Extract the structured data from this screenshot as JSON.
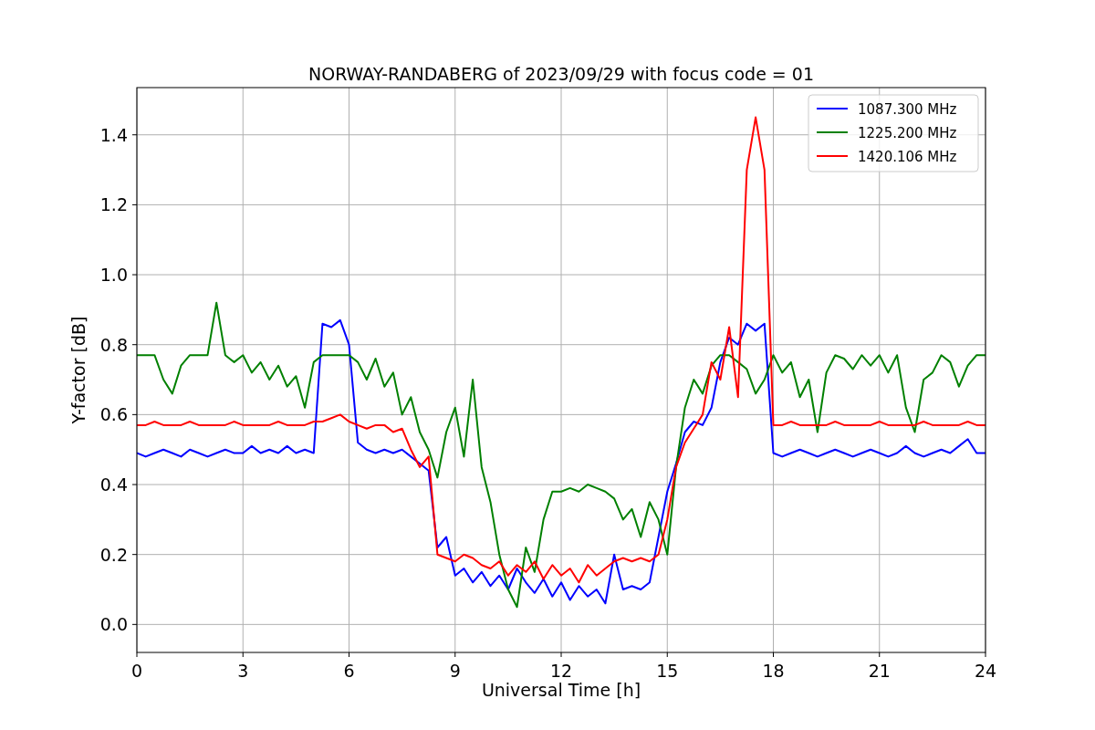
{
  "chart_data": {
    "type": "line",
    "title": "NORWAY-RANDABERG of 2023/09/29 with focus code = 01",
    "xlabel": "Universal Time [h]",
    "ylabel": "Y-factor [dB]",
    "x": [
      0,
      0.25,
      0.5,
      0.75,
      1,
      1.25,
      1.5,
      1.75,
      2,
      2.25,
      2.5,
      2.75,
      3,
      3.25,
      3.5,
      3.75,
      4,
      4.25,
      4.5,
      4.75,
      5,
      5.25,
      5.5,
      5.75,
      6,
      6.25,
      6.5,
      6.75,
      7,
      7.25,
      7.5,
      7.75,
      8,
      8.25,
      8.5,
      8.75,
      9,
      9.25,
      9.5,
      9.75,
      10,
      10.25,
      10.5,
      10.75,
      11,
      11.25,
      11.5,
      11.75,
      12,
      12.25,
      12.5,
      12.75,
      13,
      13.25,
      13.5,
      13.75,
      14,
      14.25,
      14.5,
      14.75,
      15,
      15.25,
      15.5,
      15.75,
      16,
      16.25,
      16.5,
      16.75,
      17,
      17.25,
      17.5,
      17.75,
      18,
      18.25,
      18.5,
      18.75,
      19,
      19.25,
      19.5,
      19.75,
      20,
      20.25,
      20.5,
      20.75,
      21,
      21.25,
      21.5,
      21.75,
      22,
      22.25,
      22.5,
      22.75,
      23,
      23.25,
      23.5,
      23.75,
      24
    ],
    "series": [
      {
        "name": "1087.300 MHz",
        "color": "#0000ff",
        "values": [
          0.49,
          0.48,
          0.49,
          0.5,
          0.49,
          0.48,
          0.5,
          0.49,
          0.48,
          0.49,
          0.5,
          0.49,
          0.49,
          0.51,
          0.49,
          0.5,
          0.49,
          0.51,
          0.49,
          0.5,
          0.49,
          0.86,
          0.85,
          0.87,
          0.8,
          0.52,
          0.5,
          0.49,
          0.5,
          0.49,
          0.5,
          0.48,
          0.46,
          0.44,
          0.22,
          0.25,
          0.14,
          0.16,
          0.12,
          0.15,
          0.11,
          0.14,
          0.1,
          0.16,
          0.12,
          0.09,
          0.13,
          0.08,
          0.12,
          0.07,
          0.11,
          0.08,
          0.1,
          0.06,
          0.2,
          0.1,
          0.11,
          0.1,
          0.12,
          0.25,
          0.38,
          0.46,
          0.55,
          0.58,
          0.57,
          0.62,
          0.75,
          0.82,
          0.8,
          0.86,
          0.84,
          0.86,
          0.49,
          0.48,
          0.49,
          0.5,
          0.49,
          0.48,
          0.49,
          0.5,
          0.49,
          0.48,
          0.49,
          0.5,
          0.49,
          0.48,
          0.49,
          0.51,
          0.49,
          0.48,
          0.49,
          0.5,
          0.49,
          0.51,
          0.53,
          0.49,
          0.49
        ]
      },
      {
        "name": "1225.200 MHz",
        "color": "#008000",
        "values": [
          0.77,
          0.77,
          0.77,
          0.7,
          0.66,
          0.74,
          0.77,
          0.77,
          0.77,
          0.92,
          0.77,
          0.75,
          0.77,
          0.72,
          0.75,
          0.7,
          0.74,
          0.68,
          0.71,
          0.62,
          0.75,
          0.77,
          0.77,
          0.77,
          0.77,
          0.75,
          0.7,
          0.76,
          0.68,
          0.72,
          0.6,
          0.65,
          0.55,
          0.5,
          0.42,
          0.55,
          0.62,
          0.48,
          0.7,
          0.45,
          0.35,
          0.2,
          0.1,
          0.05,
          0.22,
          0.15,
          0.3,
          0.38,
          0.38,
          0.39,
          0.38,
          0.4,
          0.39,
          0.38,
          0.36,
          0.3,
          0.33,
          0.25,
          0.35,
          0.3,
          0.2,
          0.45,
          0.62,
          0.7,
          0.66,
          0.74,
          0.77,
          0.77,
          0.75,
          0.73,
          0.66,
          0.7,
          0.77,
          0.72,
          0.75,
          0.65,
          0.7,
          0.55,
          0.72,
          0.77,
          0.76,
          0.73,
          0.77,
          0.74,
          0.77,
          0.72,
          0.77,
          0.62,
          0.55,
          0.7,
          0.72,
          0.77,
          0.75,
          0.68,
          0.74,
          0.77,
          0.77
        ]
      },
      {
        "name": "1420.106 MHz",
        "color": "#ff0000",
        "values": [
          0.57,
          0.57,
          0.58,
          0.57,
          0.57,
          0.57,
          0.58,
          0.57,
          0.57,
          0.57,
          0.57,
          0.58,
          0.57,
          0.57,
          0.57,
          0.57,
          0.58,
          0.57,
          0.57,
          0.57,
          0.58,
          0.58,
          0.59,
          0.6,
          0.58,
          0.57,
          0.56,
          0.57,
          0.57,
          0.55,
          0.56,
          0.5,
          0.45,
          0.48,
          0.2,
          0.19,
          0.18,
          0.2,
          0.19,
          0.17,
          0.16,
          0.18,
          0.14,
          0.17,
          0.15,
          0.18,
          0.13,
          0.17,
          0.14,
          0.16,
          0.12,
          0.17,
          0.14,
          0.16,
          0.18,
          0.19,
          0.18,
          0.19,
          0.18,
          0.2,
          0.3,
          0.45,
          0.52,
          0.56,
          0.6,
          0.75,
          0.7,
          0.85,
          0.65,
          1.3,
          1.45,
          1.3,
          0.57,
          0.57,
          0.58,
          0.57,
          0.57,
          0.57,
          0.57,
          0.58,
          0.57,
          0.57,
          0.57,
          0.57,
          0.58,
          0.57,
          0.57,
          0.57,
          0.57,
          0.58,
          0.57,
          0.57,
          0.57,
          0.57,
          0.58,
          0.57,
          0.57
        ]
      }
    ],
    "grid": true,
    "legend": true,
    "xlim": [
      0,
      24
    ],
    "ylim": [
      -0.08,
      1.535
    ],
    "xticks": [
      0,
      3,
      6,
      9,
      12,
      15,
      18,
      21,
      24
    ],
    "yticks": [
      {
        "value": 0,
        "label": "0.0"
      },
      {
        "value": 0.2,
        "label": "0.2"
      },
      {
        "value": 0.4,
        "label": "0.4"
      },
      {
        "value": 0.6,
        "label": "0.6"
      },
      {
        "value": 0.8,
        "label": "0.8"
      },
      {
        "value": 1,
        "label": "1.0"
      },
      {
        "value": 1.2,
        "label": "1.2"
      },
      {
        "value": 1.4,
        "label": "1.4"
      }
    ]
  }
}
